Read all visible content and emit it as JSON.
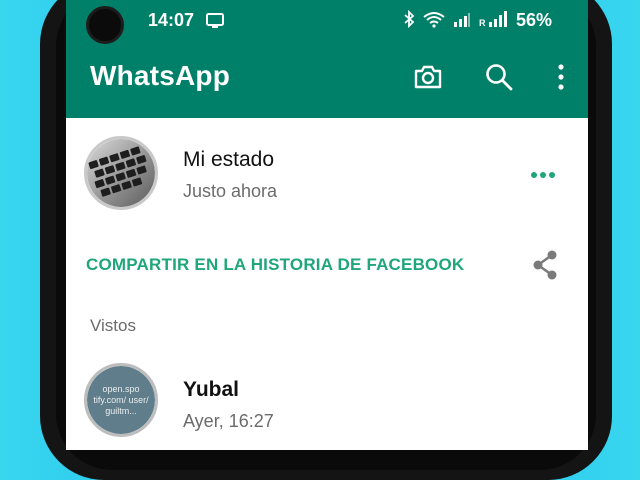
{
  "status_bar": {
    "time": "14:07",
    "signal_r_label": "R",
    "battery": "56%"
  },
  "appbar": {
    "title": "WhatsApp",
    "icons": [
      "camera-icon",
      "search-icon",
      "more-vert-icon"
    ],
    "color": "#008069"
  },
  "my_status": {
    "name": "Mi estado",
    "time": "Justo ahora"
  },
  "share": {
    "label": "COMPARTIR EN LA HISTORIA DE FACEBOOK"
  },
  "viewed": {
    "label": "Vistos",
    "items": [
      {
        "name": "Yubal",
        "time": "Ayer, 16:27",
        "avatar_text": "open.spo tify.com/ user/ guiltm..."
      }
    ]
  },
  "accent": "#1fa67a"
}
